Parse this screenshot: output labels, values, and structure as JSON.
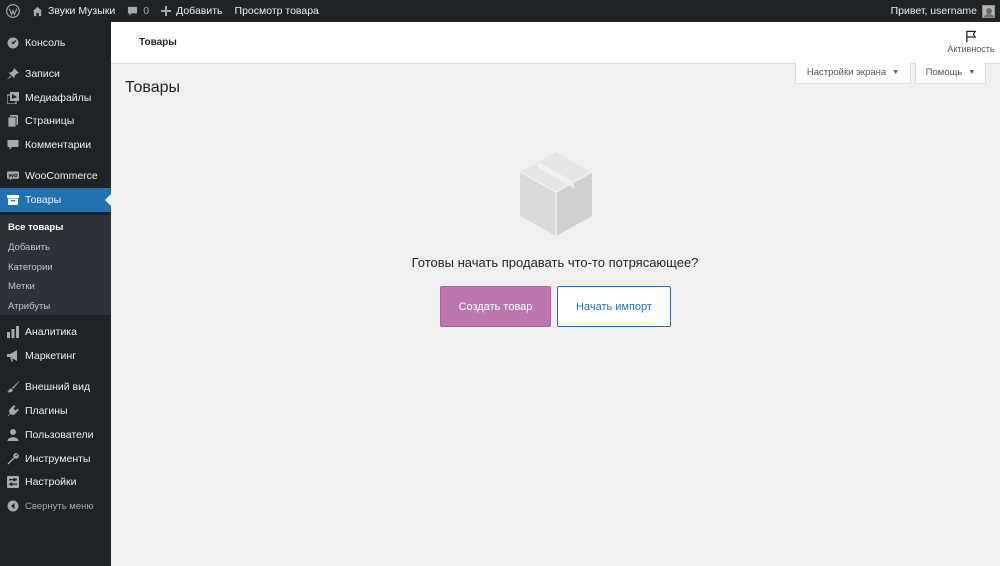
{
  "admin_bar": {
    "site_name": "Звуки Музыки",
    "comments_count": "0",
    "add_new": "Добавить",
    "view_product": "Просмотр товара",
    "greeting": "Привет, username"
  },
  "sidebar": {
    "items": [
      {
        "label": "Консоль",
        "icon": "dashboard-icon"
      },
      {
        "label": "Записи",
        "icon": "pin-icon"
      },
      {
        "label": "Медиафайлы",
        "icon": "media-icon"
      },
      {
        "label": "Страницы",
        "icon": "page-icon"
      },
      {
        "label": "Комментарии",
        "icon": "comment-icon"
      },
      {
        "label": "WooCommerce",
        "icon": "woo-icon"
      },
      {
        "label": "Товары",
        "icon": "archive-icon"
      },
      {
        "label": "Аналитика",
        "icon": "chart-icon"
      },
      {
        "label": "Маркетинг",
        "icon": "megaphone-icon"
      },
      {
        "label": "Внешний вид",
        "icon": "brush-icon"
      },
      {
        "label": "Плагины",
        "icon": "plugin-icon"
      },
      {
        "label": "Пользователи",
        "icon": "users-icon"
      },
      {
        "label": "Инструменты",
        "icon": "wrench-icon"
      },
      {
        "label": "Настройки",
        "icon": "settings-icon"
      }
    ],
    "submenu": [
      "Все товары",
      "Добавить",
      "Категории",
      "Метки",
      "Атрибуты"
    ],
    "collapse_label": "Свернуть меню",
    "accent_color": "#2271b1"
  },
  "header": {
    "title": "Товары",
    "activity_label": "Активность"
  },
  "screen_meta": {
    "screen_options": "Настройки экрана",
    "help": "Помощь"
  },
  "page": {
    "title": "Товары"
  },
  "empty_state": {
    "heading": "Готовы начать продавать что-то потрясающее?",
    "create_button": "Создать товар",
    "import_button": "Начать импорт",
    "create_color": "#bb77ae"
  }
}
